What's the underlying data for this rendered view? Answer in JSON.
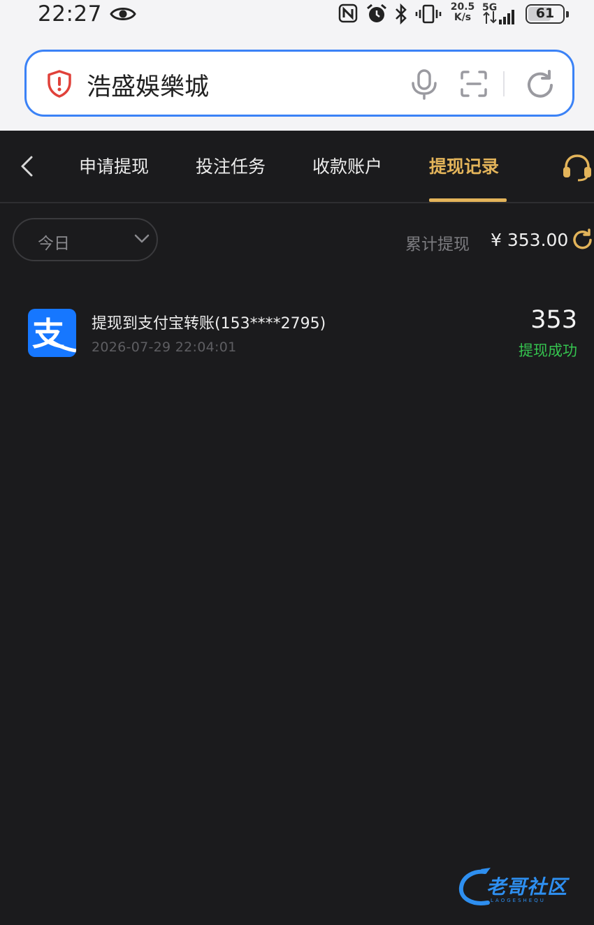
{
  "status_bar": {
    "time": "22:27",
    "net_speed_value": "20.5",
    "net_speed_unit": "K/s",
    "network_type": "5G",
    "battery_level": "61",
    "battery_fraction": 0.61
  },
  "browser": {
    "url_text": "浩盛娛樂城"
  },
  "tabs": [
    {
      "label": "申请提现"
    },
    {
      "label": "投注任务"
    },
    {
      "label": "收款账户"
    },
    {
      "label": "提现记录"
    }
  ],
  "active_tab": "提现记录",
  "filter": {
    "selected": "今日"
  },
  "summary": {
    "label": "累计提现",
    "value": "¥ 353.00"
  },
  "records": [
    {
      "title": "提现到支付宝转账(153****2795)",
      "time": "2026-07-29 22:04:01",
      "amount": "353",
      "status": "提现成功",
      "icon_glyph": "支"
    }
  ],
  "watermark": {
    "text": "老哥社区",
    "sub": "LAOGESHEQU"
  },
  "colors": {
    "accent_gold": "#e3b45a",
    "success_green": "#35c44f",
    "background": "#1b1b1d",
    "alipay_blue": "#1677ff",
    "url_border": "#3b82f6"
  },
  "icons": [
    "eye-icon",
    "nfc-icon",
    "alarm-icon",
    "bluetooth-icon",
    "vibrate-icon",
    "signal-icon",
    "battery-icon",
    "shield-icon",
    "mic-icon",
    "scan-icon",
    "refresh-icon",
    "back-icon",
    "headset-icon",
    "chevron-down-icon",
    "alipay-icon"
  ]
}
